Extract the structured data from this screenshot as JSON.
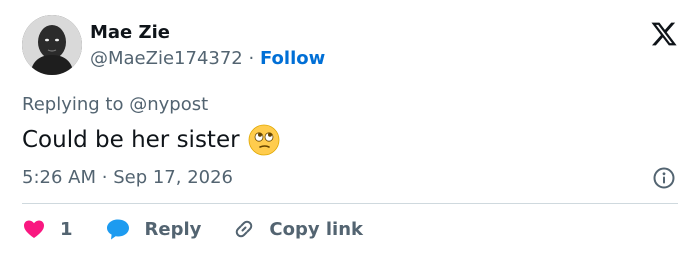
{
  "author": {
    "name": "Mae Zie",
    "handle": "@MaeZie174372",
    "separator": "·",
    "follow_label": "Follow"
  },
  "reply_context": {
    "prefix": "Replying to",
    "mention": "@nypost"
  },
  "tweet": {
    "text": "Could be her sister",
    "emoji": "face-with-rolling-eyes"
  },
  "timestamp": {
    "time": "5:26 AM",
    "separator": "·",
    "date": "Sep 17, 2026"
  },
  "actions": {
    "like_count": "1",
    "reply_label": "Reply",
    "copy_link_label": "Copy link"
  },
  "icons": {
    "brand": "x-logo-icon",
    "info": "info-icon",
    "like": "heart-icon",
    "reply": "speech-bubble-icon",
    "copy": "link-icon"
  },
  "colors": {
    "follow": "#006fd6",
    "heart": "#f91880",
    "reply_bubble": "#1d9bf0",
    "secondary_text": "#536471",
    "divider": "#cfd9de"
  }
}
